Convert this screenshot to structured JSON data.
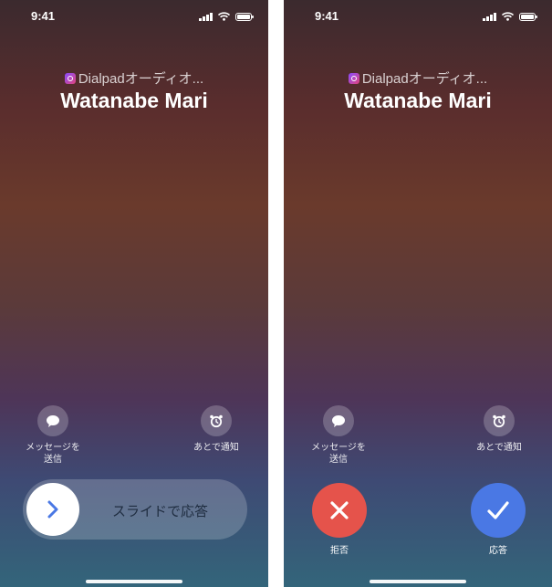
{
  "colors": {
    "decline": "#e5534b",
    "answer": "#4a78e4",
    "slider_text": "#1f2d40",
    "knob_arrow": "#4a78e4"
  },
  "left_screen": {
    "status_time": "9:41",
    "caller_app": "Dialpadオーディオ...",
    "caller_name": "Watanabe Mari",
    "message_label_line1": "メッセージを",
    "message_label_line2": "送信",
    "message_icon": "speech-bubble-icon",
    "remind_label": "あとで通知",
    "remind_icon": "alarm-clock-icon",
    "slider_text": "スライドで応答",
    "knob_icon": "chevron-right-icon"
  },
  "right_screen": {
    "status_time": "9:41",
    "caller_app": "Dialpadオーディオ...",
    "caller_name": "Watanabe Mari",
    "message_label_line1": "メッセージを",
    "message_label_line2": "送信",
    "message_icon": "speech-bubble-icon",
    "remind_label": "あとで通知",
    "remind_icon": "alarm-clock-icon",
    "decline_label": "拒否",
    "decline_icon": "x-icon",
    "answer_label": "応答",
    "answer_icon": "checkmark-icon"
  }
}
